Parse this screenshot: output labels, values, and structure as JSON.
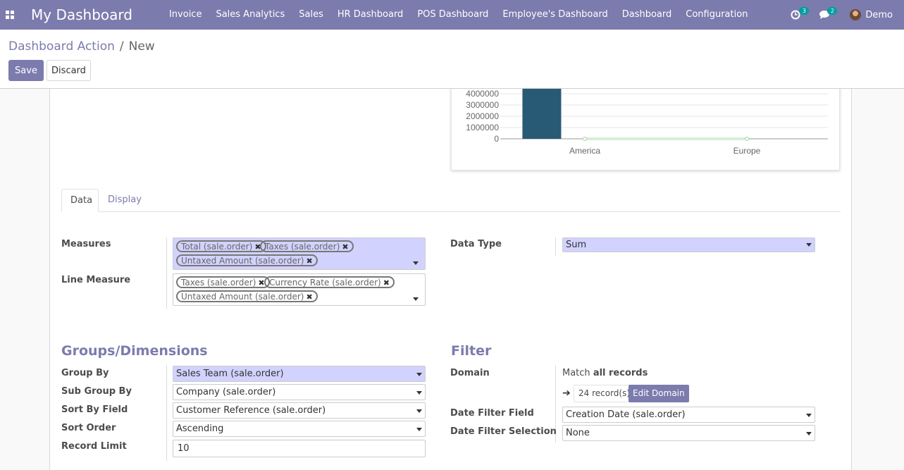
{
  "navbar": {
    "brand": "My Dashboard",
    "menu": [
      "Invoice",
      "Sales Analytics",
      "Sales",
      "HR Dashboard",
      "POS Dashboard",
      "Employee's Dashboard",
      "Dashboard",
      "Configuration"
    ],
    "activity_count": "3",
    "messages_count": "2",
    "user": "Demo",
    "colors": {
      "bar": "#7c7bad",
      "badge": "#00a09d"
    }
  },
  "breadcrumb": {
    "parent": "Dashboard Action",
    "separator": "/",
    "current": "New"
  },
  "buttons": {
    "save": "Save",
    "discard": "Discard"
  },
  "chart_data": {
    "type": "bar",
    "categories": [
      "America",
      "Europe"
    ],
    "y_ticks": [
      "4000000",
      "3000000",
      "2000000",
      "1000000",
      "0"
    ],
    "series": [
      {
        "values": [
          4800000,
          0
        ],
        "color": "#285a75"
      }
    ],
    "line_series": [
      {
        "values": [
          0,
          0
        ],
        "color": "#d8edd8"
      }
    ],
    "ylim": [
      0,
      4000000
    ],
    "grid": true
  },
  "tabs": {
    "data": "Data",
    "display": "Display"
  },
  "fields": {
    "measures": {
      "label": "Measures",
      "tags": [
        "Total (sale.order)",
        "Taxes (sale.order)",
        "Untaxed Amount (sale.order)"
      ]
    },
    "line_measure": {
      "label": "Line Measure",
      "tags": [
        "Taxes (sale.order)",
        "Currency Rate (sale.order)",
        "Untaxed Amount (sale.order)"
      ]
    },
    "data_type": {
      "label": "Data Type",
      "value": "Sum"
    }
  },
  "groups": {
    "title": "Groups/Dimensions",
    "group_by": {
      "label": "Group By",
      "value": "Sales Team (sale.order)"
    },
    "sub_group_by": {
      "label": "Sub Group By",
      "value": "Company (sale.order)"
    },
    "sort_by_field": {
      "label": "Sort By Field",
      "value": "Customer Reference (sale.order)"
    },
    "sort_order": {
      "label": "Sort Order",
      "value": "Ascending"
    },
    "record_limit": {
      "label": "Record Limit",
      "value": "10"
    }
  },
  "filter": {
    "title": "Filter",
    "domain": {
      "label": "Domain",
      "prefix": "Match",
      "emphasis": "all records",
      "records": "24 record(s)",
      "edit_label": "Edit Domain"
    },
    "date_filter_field": {
      "label": "Date Filter Field",
      "value": "Creation Date (sale.order)"
    },
    "date_filter_selection": {
      "label": "Date Filter Selection",
      "value": "None"
    }
  }
}
